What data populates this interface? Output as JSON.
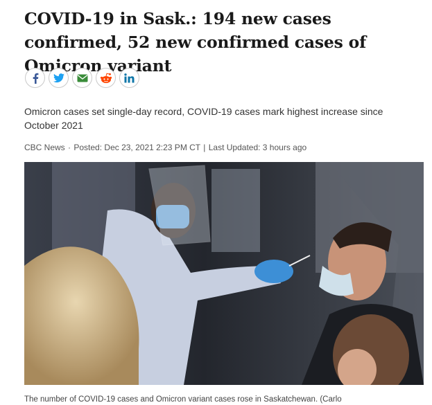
{
  "article": {
    "headline": "COVID-19 in Sask.: 194 new cases confirmed, 52 new confirmed cases of Omicron variant",
    "deck": "Omicron cases set single-day record, COVID-19 cases mark highest increase since October 2021",
    "byline": {
      "source": "CBC News",
      "separator": "·",
      "posted": "Posted: Dec 23, 2021 2:23 PM CT",
      "divider": "|",
      "updated": "Last Updated: 3 hours ago"
    },
    "caption": "The number of COVID-19 cases and Omicron variant cases rose in Saskatchewan. (Carlo"
  },
  "share": {
    "buttons": [
      {
        "icon": "facebook-icon",
        "color": "#3b5998"
      },
      {
        "icon": "twitter-icon",
        "color": "#1da1f2"
      },
      {
        "icon": "email-icon",
        "color": "#3a8c3a"
      },
      {
        "icon": "reddit-icon",
        "color": "#ff4500"
      },
      {
        "icon": "linkedin-icon",
        "color": "#0e76a8"
      }
    ]
  }
}
